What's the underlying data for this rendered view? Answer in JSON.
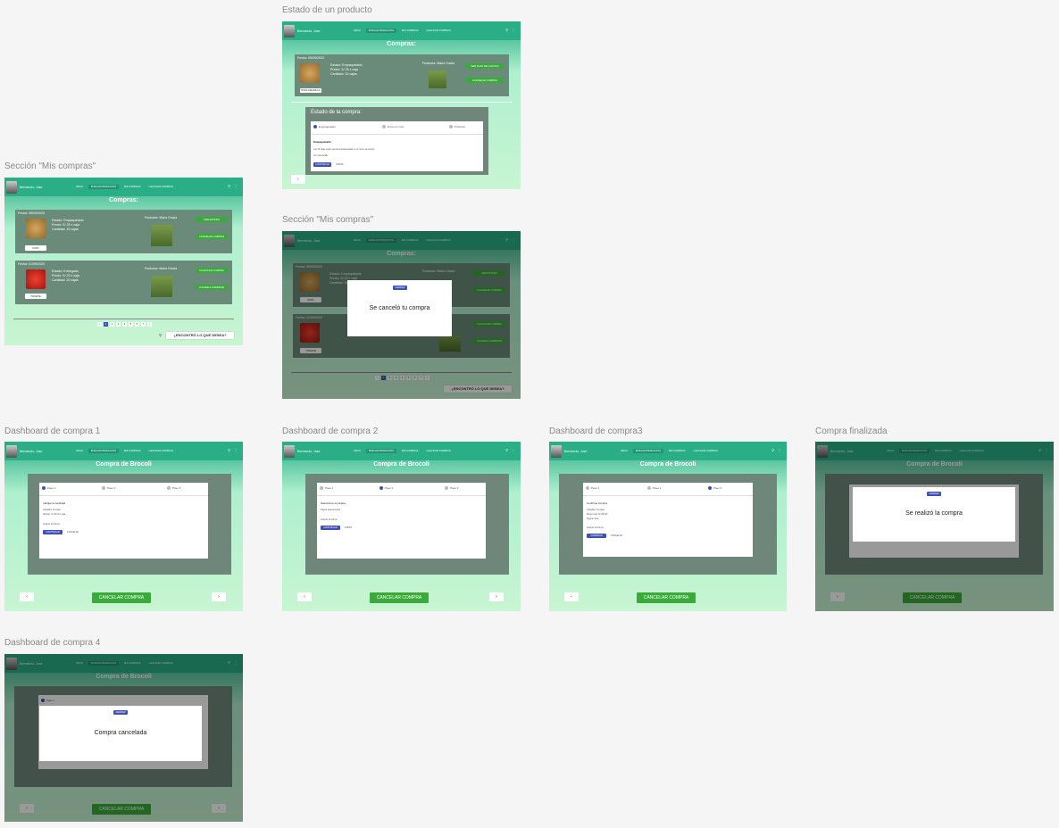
{
  "labels": {
    "estado": "Estado de un producto",
    "mis1": "Sección \"Mis compras\"",
    "mis2": "Sección \"Mis compras\"",
    "d1": "Dashboard de compra 1",
    "d2": "Dashboard de compra 2",
    "d3": "Dashboard de compra3",
    "fin": "Compra finalizada",
    "d4": "Dashboard de compra 4"
  },
  "header": {
    "user": "Bermendo, Jose",
    "nav": [
      "INICIO",
      "BUSCAR PRODUCTOS",
      "MIS COMPRAS",
      "CALIFICAR COMPRAS"
    ]
  },
  "titles": {
    "compras": "Compras:",
    "brocoli": "Compra de Brocoli"
  },
  "cards": {
    "papa": {
      "date": "Fecha: 05/09/2020",
      "estado": "Estado: Empaquetado",
      "precio": "Precio: S/ 25 x caja",
      "cantidad": "Cantidad: 15 cajas",
      "productor": "Productor: María Gracia",
      "btn1": "VER ESTADO",
      "btn2": "CANCELAR COMPRA",
      "tag": "PAPA"
    },
    "tomate": {
      "date": "Fecha: 01/09/2020",
      "estado": "Estado: Entregado",
      "precio": "Precio: S/ 20 x caja",
      "cantidad": "Cantidad: 20 cajas",
      "productor": "Productor: María Gracia",
      "btn1": "CALIFICAR COMPRA",
      "btn2": "VOLVER A COMPRAR",
      "tag": "TOMATE"
    },
    "papa2": {
      "date": "Fecha: 05/09/2020",
      "estado": "Estado: Empaquetado",
      "precio": "Precio: S/ 25 x caja",
      "cantidad": "Cantidad: 10 cajas",
      "productor": "Productor: María Gracia",
      "btn1": "VER PLAN DE CULTIVO",
      "btn2": "CANCELAR COMPRA",
      "tag": "PAPA AMARILLA"
    }
  },
  "pages": [
    "‹",
    "1",
    "2",
    "3",
    "4",
    "5",
    "6",
    "7",
    "›"
  ],
  "found": "¿ENCONTRÓ LO QUE DESEA?",
  "estado": {
    "title": "Estado de la compra:",
    "steps": [
      "Empaquetado",
      "Envío en ruta",
      "Producto"
    ],
    "step_sub": "Paso 1",
    "head": "Empaquetado",
    "desc": "Las 15 cajas están siendo empaquetadas en el centro de acopio",
    "more": "Ver más detalle",
    "btn_ok": "CONTINUAR",
    "btn_back": "ATRÁS"
  },
  "modals": {
    "cancel": "Se canceló tu compra",
    "done": "Se realizó la compra",
    "cancelled": "Compra cancelada",
    "close": "CERRAR"
  },
  "dash": {
    "s1": {
      "steps": [
        "Paso 1",
        "Paso 2",
        "Paso 3"
      ],
      "sub": "Cantidad",
      "head": "Indique la cantidad",
      "l1": "Cantidad: 10 cajas",
      "l2": "Mostrar: S/ 25.00 x caja",
      "chk": "Acepto términos",
      "b1": "CONTINUAR",
      "b2": "CANCELAR"
    },
    "s2": {
      "steps": [
        "Paso 1",
        "Paso 2",
        "Paso 3"
      ],
      "head": "Seleccione su tarjeta",
      "l1": "Tarjeta seleccionada",
      "chk": "Acepto términos",
      "b1": "CONTINUAR",
      "b2": "ATRÁS"
    },
    "s3": {
      "steps": [
        "Paso 1",
        "Paso 2",
        "Paso 3"
      ],
      "head": "Confirme compra",
      "l1": "Cantidad: 10 cajas",
      "l2": "Monto total: S/ 250.00",
      "l3": "Tarjeta: Visa",
      "chk": "Acepto términos",
      "b1": "COMPRAR",
      "b2": "CANCELAR"
    },
    "cancel": "CANCELAR COMPRA"
  },
  "colors": {
    "accent": "#2aae86",
    "green_btn": "#3aaa3a",
    "blue": "#3f51b5"
  }
}
